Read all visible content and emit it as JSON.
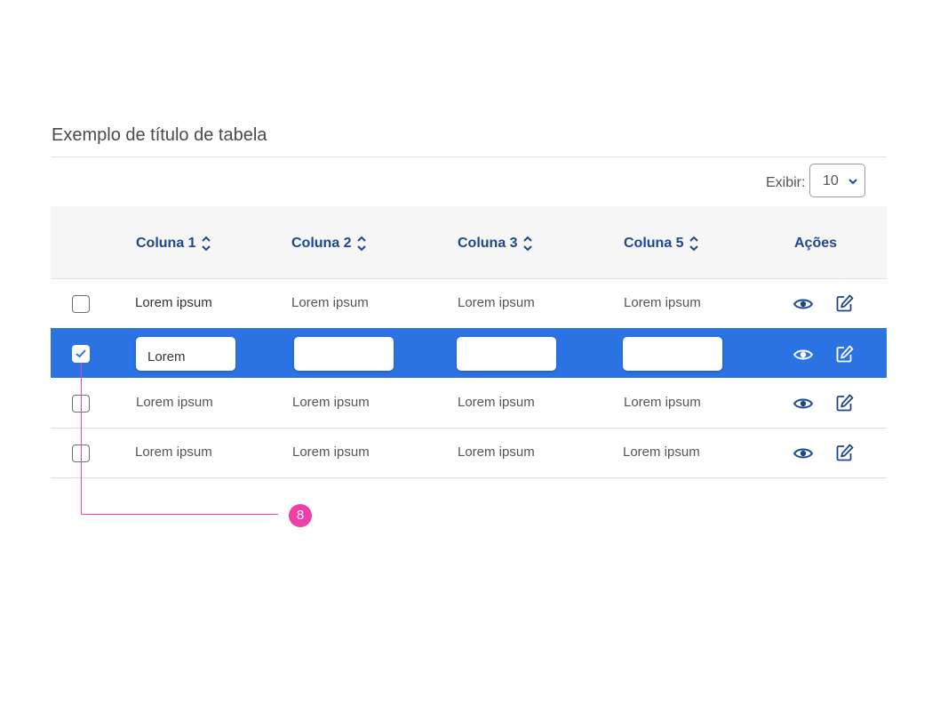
{
  "table": {
    "title": "Exemplo de título de tabela",
    "show_label": "Exibir:",
    "page_size": "10",
    "columns": [
      "Coluna 1",
      "Coluna 2",
      "Coluna 3",
      "Coluna 5"
    ],
    "actions_label": "Ações",
    "rows": [
      {
        "checked": false,
        "cells": [
          "Lorem ipsum",
          "Lorem ipsum",
          "Lorem ipsum",
          "Lorem ipsum"
        ]
      },
      {
        "checked": true,
        "editing": true,
        "cells": [
          "Lorem",
          "",
          "",
          ""
        ]
      },
      {
        "checked": false,
        "cells": [
          "Lorem ipsum",
          "Lorem ipsum",
          "Lorem ipsum",
          "Lorem ipsum"
        ]
      },
      {
        "checked": false,
        "cells": [
          "Lorem ipsum",
          "Lorem ipsum",
          "Lorem ipsum",
          "Lorem ipsum"
        ]
      }
    ]
  },
  "annotation": {
    "marker": "8"
  },
  "icons": {
    "view": "eye-icon",
    "edit": "edit-icon",
    "sort": "sort-icon",
    "select": "chevron-down-icon",
    "check": "check-icon"
  },
  "colors": {
    "primary": "#2b73e3",
    "header_text": "#1f4690",
    "annotation": "#f03ea8"
  }
}
